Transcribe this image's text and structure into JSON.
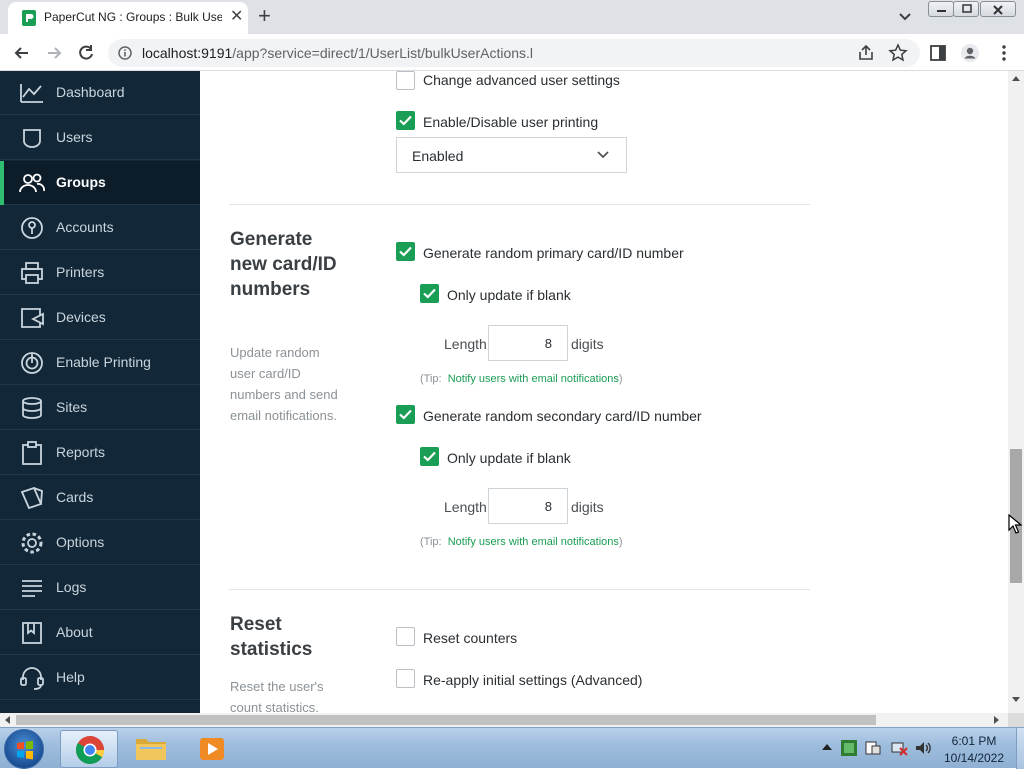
{
  "browser": {
    "tab_title": "PaperCut NG : Groups : Bulk User Actions",
    "url_host": "localhost:9191",
    "url_path": "/app?service=direct/1/UserList/bulkUserActions.l"
  },
  "sidebar": {
    "items": [
      {
        "label": "Dashboard",
        "icon": "chart-line-icon"
      },
      {
        "label": "Users",
        "icon": "user-icon"
      },
      {
        "label": "Groups",
        "icon": "users-icon",
        "active": true
      },
      {
        "label": "Accounts",
        "icon": "lock-icon"
      },
      {
        "label": "Printers",
        "icon": "printer-icon"
      },
      {
        "label": "Devices",
        "icon": "device-icon"
      },
      {
        "label": "Enable Printing",
        "icon": "enable-printing-icon"
      },
      {
        "label": "Sites",
        "icon": "database-icon"
      },
      {
        "label": "Reports",
        "icon": "clipboard-icon"
      },
      {
        "label": "Cards",
        "icon": "cards-icon"
      },
      {
        "label": "Options",
        "icon": "gear-icon"
      },
      {
        "label": "Logs",
        "icon": "list-icon"
      },
      {
        "label": "About",
        "icon": "bookmark-icon"
      },
      {
        "label": "Help",
        "icon": "headset-icon"
      }
    ]
  },
  "main": {
    "change_advanced": {
      "label": "Change advanced user settings",
      "checked": false
    },
    "enable_printing": {
      "label": "Enable/Disable user printing",
      "checked": true,
      "select_value": "Enabled"
    },
    "card_section": {
      "title": "Generate new card/ID numbers",
      "description": "Update random user card/ID numbers and send email notifications.",
      "primary": {
        "label": "Generate random primary card/ID number",
        "checked": true,
        "only_blank_label": "Only update if blank",
        "only_blank_checked": true,
        "length_label": "Length",
        "length_value": "8",
        "digits_label": "digits",
        "tip_prefix": "(Tip:",
        "tip_link": "Notify users with email notifications",
        "tip_suffix": ")"
      },
      "secondary": {
        "label": "Generate random secondary card/ID number",
        "checked": true,
        "only_blank_label": "Only update if blank",
        "only_blank_checked": true,
        "length_label": "Length",
        "length_value": "8",
        "digits_label": "digits",
        "tip_prefix": "(Tip:",
        "tip_link": "Notify users with email notifications",
        "tip_suffix": ")"
      }
    },
    "reset_section": {
      "title": "Reset statistics",
      "description": "Reset the user's count statistics.",
      "reset_counters": {
        "label": "Reset counters",
        "checked": false
      },
      "reapply": {
        "label": "Re-apply initial settings (Advanced)",
        "checked": false
      }
    }
  },
  "taskbar": {
    "time": "6:01 PM",
    "date": "10/14/2022"
  },
  "colors": {
    "accent": "#1a9d54",
    "sidebar_bg": "#122838"
  }
}
